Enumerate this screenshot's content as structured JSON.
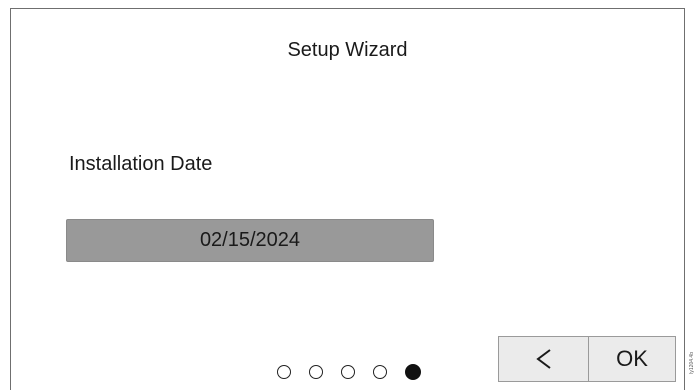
{
  "wizard": {
    "title": "Setup Wizard",
    "field_label": "Installation Date",
    "date_value": "02/15/2024"
  },
  "pager": {
    "total_steps": 5,
    "current_step": 5
  },
  "buttons": {
    "back_icon": "chevron-left-icon",
    "ok_label": "OK"
  },
  "side_tag": "ly1204.4b"
}
